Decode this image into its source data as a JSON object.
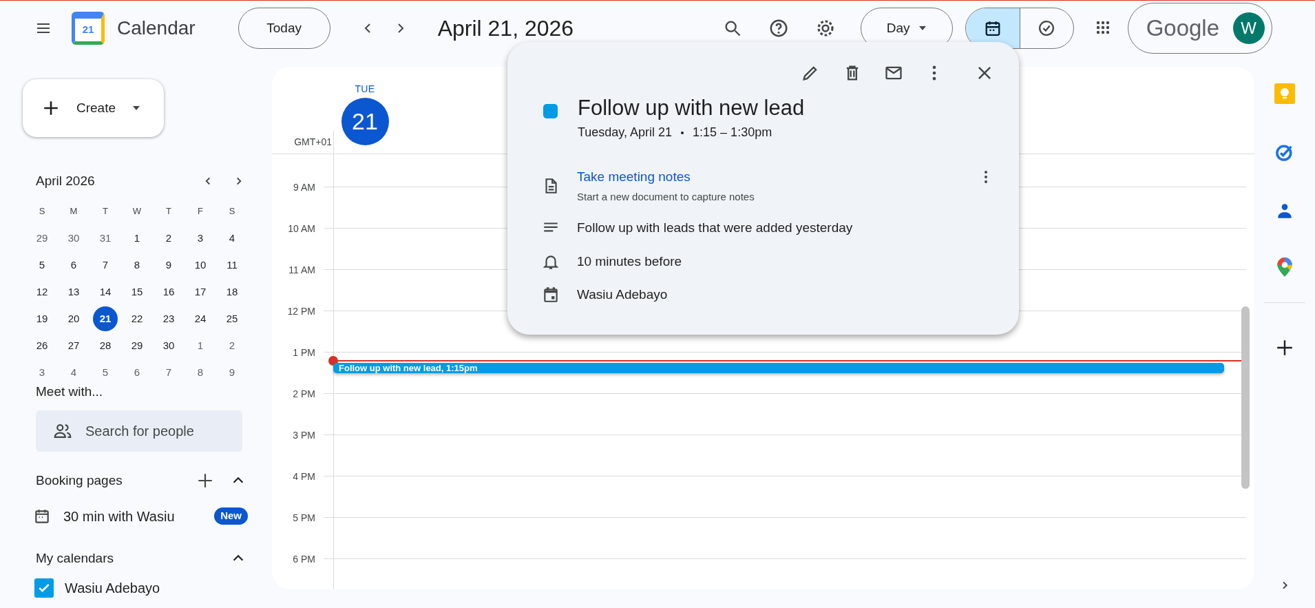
{
  "header": {
    "app_name": "Calendar",
    "logo_date": "21",
    "today_button": "Today",
    "date_title": "April 21, 2026",
    "view_select": "Day",
    "view_toggle": [
      {
        "kind": "calendar",
        "selected": true
      },
      {
        "kind": "tasks",
        "selected": false
      }
    ],
    "account": {
      "brand": "Google",
      "avatar_letter": "W"
    }
  },
  "sidebar": {
    "create_button": "Create",
    "mini_calendar": {
      "title": "April 2026",
      "weekdays": [
        "S",
        "M",
        "T",
        "W",
        "T",
        "F",
        "S"
      ],
      "weeks": [
        [
          {
            "day": "29",
            "muted": true,
            "selected": false
          },
          {
            "day": "30",
            "muted": true,
            "selected": false
          },
          {
            "day": "31",
            "muted": true,
            "selected": false
          },
          {
            "day": "1",
            "muted": false,
            "selected": false
          },
          {
            "day": "2",
            "muted": false,
            "selected": false
          },
          {
            "day": "3",
            "muted": false,
            "selected": false
          },
          {
            "day": "4",
            "muted": false,
            "selected": false
          }
        ],
        [
          {
            "day": "5",
            "muted": false,
            "selected": false
          },
          {
            "day": "6",
            "muted": false,
            "selected": false
          },
          {
            "day": "7",
            "muted": false,
            "selected": false
          },
          {
            "day": "8",
            "muted": false,
            "selected": false
          },
          {
            "day": "9",
            "muted": false,
            "selected": false
          },
          {
            "day": "10",
            "muted": false,
            "selected": false
          },
          {
            "day": "11",
            "muted": false,
            "selected": false
          }
        ],
        [
          {
            "day": "12",
            "muted": false,
            "selected": false
          },
          {
            "day": "13",
            "muted": false,
            "selected": false
          },
          {
            "day": "14",
            "muted": false,
            "selected": false
          },
          {
            "day": "15",
            "muted": false,
            "selected": false
          },
          {
            "day": "16",
            "muted": false,
            "selected": false
          },
          {
            "day": "17",
            "muted": false,
            "selected": false
          },
          {
            "day": "18",
            "muted": false,
            "selected": false
          }
        ],
        [
          {
            "day": "19",
            "muted": false,
            "selected": false
          },
          {
            "day": "20",
            "muted": false,
            "selected": false
          },
          {
            "day": "21",
            "muted": false,
            "selected": true
          },
          {
            "day": "22",
            "muted": false,
            "selected": false
          },
          {
            "day": "23",
            "muted": false,
            "selected": false
          },
          {
            "day": "24",
            "muted": false,
            "selected": false
          },
          {
            "day": "25",
            "muted": false,
            "selected": false
          }
        ],
        [
          {
            "day": "26",
            "muted": false,
            "selected": false
          },
          {
            "day": "27",
            "muted": false,
            "selected": false
          },
          {
            "day": "28",
            "muted": false,
            "selected": false
          },
          {
            "day": "29",
            "muted": false,
            "selected": false
          },
          {
            "day": "30",
            "muted": false,
            "selected": false
          },
          {
            "day": "1",
            "muted": true,
            "selected": false
          },
          {
            "day": "2",
            "muted": true,
            "selected": false
          }
        ],
        [
          {
            "day": "3",
            "muted": true,
            "selected": false
          },
          {
            "day": "4",
            "muted": true,
            "selected": false
          },
          {
            "day": "5",
            "muted": true,
            "selected": false
          },
          {
            "day": "6",
            "muted": true,
            "selected": false
          },
          {
            "day": "7",
            "muted": true,
            "selected": false
          },
          {
            "day": "8",
            "muted": true,
            "selected": false
          },
          {
            "day": "9",
            "muted": true,
            "selected": false
          }
        ]
      ]
    },
    "meet_with": {
      "heading": "Meet with...",
      "search_placeholder": "Search for people"
    },
    "booking_pages": {
      "heading": "Booking pages",
      "expanded": true,
      "items": [
        {
          "label": "30 min with Wasiu",
          "badge": "New"
        }
      ]
    },
    "my_calendars": {
      "heading": "My calendars",
      "expanded": true,
      "items": [
        {
          "label": "Wasiu Adebayo",
          "checked": true,
          "color": "#039be5"
        }
      ]
    }
  },
  "day_view": {
    "weekday": "TUE",
    "date": "21",
    "timezone": "GMT+01",
    "hours": [
      "9 AM",
      "10 AM",
      "11 AM",
      "12 PM",
      "1 PM",
      "2 PM",
      "3 PM",
      "4 PM",
      "5 PM",
      "6 PM"
    ],
    "events": [
      {
        "title": "Follow up with new lead, 1:15pm",
        "color": "#039be5"
      }
    ]
  },
  "popup": {
    "title": "Follow up with new lead",
    "color": "#039be5",
    "date": "Tuesday, April 21",
    "time": "1:15 – 1:30pm",
    "attachment": {
      "title": "Take meeting notes",
      "subtitle": "Start a new document to capture notes"
    },
    "description": "Follow up with leads that were added yesterday",
    "reminder": "10 minutes before",
    "calendar": "Wasiu Adebayo"
  }
}
